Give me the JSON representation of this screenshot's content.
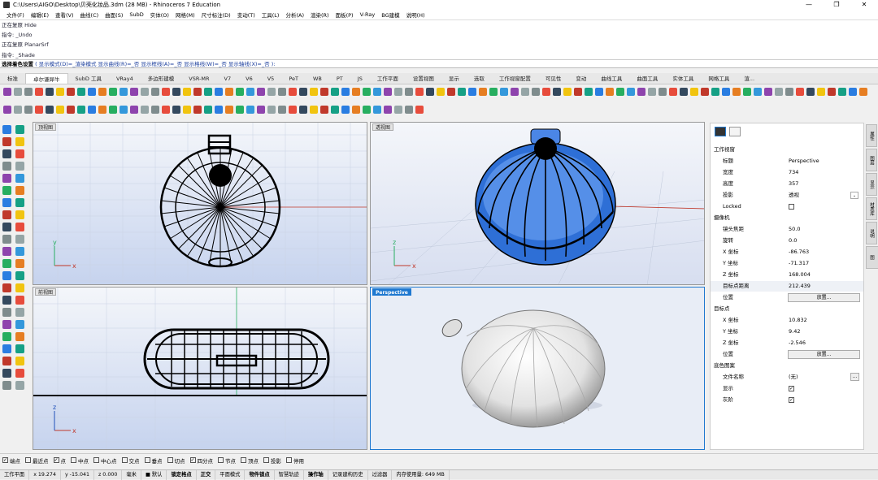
{
  "window": {
    "title": "C:\\Users\\AIGO\\Desktop\\贝壳化妆品.3dm (28 MB) - Rhinoceros 7 Education",
    "controls": [
      "—",
      "❐",
      "✕"
    ]
  },
  "menu": [
    "文件(F)",
    "编辑(E)",
    "查看(V)",
    "曲线(C)",
    "曲面(S)",
    "SubD",
    "实体(O)",
    "网格(M)",
    "尺寸标注(D)",
    "变动(T)",
    "工具(L)",
    "分析(A)",
    "渲染(R)",
    "面板(P)",
    "V-Ray",
    "BG建模",
    "说明(H)"
  ],
  "command_history": [
    "正在复原 Hide",
    "指令: _Undo",
    "正在复原 PlanarSrf",
    "指令: _Shade"
  ],
  "command_prompt": {
    "bold": "选择着色设置",
    "options": "( 显示模式(D)=_渲染模式 显示曲线(R)=_否 显示框线(A)=_否 显示格线(W)=_否 显示轴线(X)=_否 ):"
  },
  "toolbar_tabs": [
    "标准",
    "卓尔谦犀牛",
    "SubD 工具",
    "VRay4",
    "多边形建模",
    "VSR-MR",
    "V7",
    "V6",
    "V5",
    "PeT",
    "WB",
    "PT",
    "JS",
    "工作平面",
    "设置视图",
    "显示",
    "选取",
    "工作视窗配置",
    "可见性",
    "变动",
    "曲线工具",
    "曲面工具",
    "实体工具",
    "网格工具",
    "渲..."
  ],
  "active_tab": 1,
  "viewports": [
    {
      "title": "顶视图",
      "axes": [
        "x",
        "y"
      ],
      "active": false
    },
    {
      "title": "透视图",
      "axes": [
        "x",
        "z"
      ],
      "active": false
    },
    {
      "title": "前视图",
      "axes": [
        "x",
        "z"
      ],
      "active": false
    },
    {
      "title": "Perspective",
      "axes": [],
      "active": true
    }
  ],
  "properties": {
    "section1": "工作视窗",
    "rows1": [
      {
        "k": "标题",
        "v": "Perspective"
      },
      {
        "k": "宽度",
        "v": "734"
      },
      {
        "k": "高度",
        "v": "357"
      },
      {
        "k": "投影",
        "v": "透视"
      },
      {
        "k": "Locked",
        "v": ""
      }
    ],
    "section2": "摄像机",
    "rows2": [
      {
        "k": "镜头焦距",
        "v": "50.0"
      },
      {
        "k": "旋转",
        "v": "0.0"
      },
      {
        "k": "X 坐标",
        "v": "-86.763"
      },
      {
        "k": "Y 坐标",
        "v": "-71.317"
      },
      {
        "k": "Z 坐标",
        "v": "168.004"
      },
      {
        "k": "目标点距离",
        "v": "212.439"
      },
      {
        "k": "位置",
        "v": ""
      }
    ],
    "section3": "目标点",
    "rows3": [
      {
        "k": "X 坐标",
        "v": "10.832"
      },
      {
        "k": "Y 坐标",
        "v": "9.42"
      },
      {
        "k": "Z 坐标",
        "v": "-2.546"
      },
      {
        "k": "位置",
        "v": ""
      }
    ],
    "section4": "底色图案",
    "rows4": [
      {
        "k": "文件名称",
        "v": "(无)"
      },
      {
        "k": "显示",
        "v": ""
      },
      {
        "k": "灰阶",
        "v": ""
      }
    ],
    "place_btn": "放置...",
    "browse_btn": "..."
  },
  "right_tabs": [
    "属性",
    "图层",
    "显示",
    "材质库",
    "说明",
    "已命名视图"
  ],
  "osnaps": [
    {
      "l": "端点",
      "c": true
    },
    {
      "l": "最近点",
      "c": false
    },
    {
      "l": "点",
      "c": true
    },
    {
      "l": "中点",
      "c": false
    },
    {
      "l": "中心点",
      "c": false
    },
    {
      "l": "交点",
      "c": false
    },
    {
      "l": "垂点",
      "c": false
    },
    {
      "l": "切点",
      "c": false
    },
    {
      "l": "四分点",
      "c": true
    },
    {
      "l": "节点",
      "c": false
    },
    {
      "l": "顶点",
      "c": false
    },
    {
      "l": "投影",
      "c": false
    },
    {
      "l": "停用",
      "c": false
    }
  ],
  "status": [
    "工作平面",
    "x 19.274",
    "y -15.041",
    "z 0.000",
    "毫米",
    "■ 默认",
    "锁定格点",
    "正交",
    "平面模式",
    "物件锁点",
    "智慧轨迹",
    "操作轴",
    "记录建构历史",
    "过滤器",
    "内存使用量: 649 MB"
  ],
  "status_bold": [
    6,
    7,
    9,
    11
  ],
  "colors": {
    "accent": "#1e78d0",
    "viewport_bg_top": "#f4f6fa",
    "viewport_bg_bottom": "#8aa3d8",
    "shell_blue": "#3a7ae0"
  }
}
